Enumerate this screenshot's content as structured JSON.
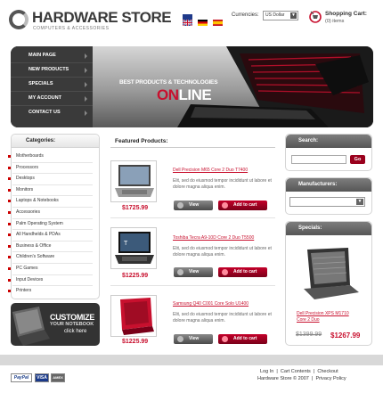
{
  "header": {
    "logo_title": "HARDWARE STORE",
    "logo_subtitle": "COMPUTERS & ACCESSORIES",
    "currencies_label": "Currencies:",
    "currency_selected": "US Dollar",
    "cart_title": "Shopping Cart:",
    "cart_items": "(0) items"
  },
  "nav": {
    "items": [
      {
        "label": "MAIN PAGE"
      },
      {
        "label": "NEW PRODUCTS"
      },
      {
        "label": "SPECIALS"
      },
      {
        "label": "MY ACCOUNT"
      },
      {
        "label": "CONTACT US"
      }
    ]
  },
  "banner": {
    "line1": "BEST PRODUCTS & TECHNOLOGIES",
    "line2_red": "ON",
    "line2_white": "LINE"
  },
  "categories": {
    "title": "Categories:",
    "items": [
      "Motherboards",
      "Processors",
      "Desktops",
      "Monitors",
      "Laptops & Notebooks",
      "Accessories",
      "Palm Operating System",
      "All Handhelds & PDAs",
      "Business & Office",
      "Children's Software",
      "PC Games",
      "Input Devices",
      "Printers"
    ]
  },
  "customize": {
    "line1": "CUSTOMIZE",
    "line2": "YOUR NOTEBOOK",
    "line3": "click here"
  },
  "featured": {
    "title": "Featured Products:",
    "products": [
      {
        "name": "Dell Precision M65 Core 2 Duo T7400",
        "description": "Elit, sed do eiusmod tempor incididunt ut labore et dolore magna aliqua enim.",
        "price": "$1725.99",
        "view_label": "View",
        "cart_label": "Add to cart"
      },
      {
        "name": "Toshiba Tecra A9-10D Core 2 Duo T5500",
        "description": "Elit, sed do eiusmod tempor incididunt ut labore et dolore magna aliqua enim.",
        "price": "$1225.99",
        "view_label": "View",
        "cart_label": "Add to cart"
      },
      {
        "name": "Samsung Q40 C001 Core Solo U1400",
        "description": "Elit, sed do eiusmod tempor incididunt ut labore et dolore magna aliqua enim.",
        "price": "$1225.99",
        "view_label": "View",
        "cart_label": "Add to cart"
      }
    ]
  },
  "search": {
    "title": "Search:",
    "go_label": "Go"
  },
  "manufacturers": {
    "title": "Manufacturers:"
  },
  "specials": {
    "title": "Specials:",
    "name": "Dell Precision XPS M1710 Core 2 Duo",
    "old_price": "$1399.99",
    "new_price": "$1267.99"
  },
  "footer": {
    "link_login": "Log In",
    "link_cart": "Cart Contents",
    "link_checkout": "Checkout",
    "copyright": "Hardware Store © 2007",
    "link_privacy": "Privacy Policy",
    "payment": [
      "PayPal",
      "VISA",
      "AMEX"
    ]
  },
  "colors": {
    "accent": "#c8102e",
    "dark": "#3a3a3a"
  }
}
